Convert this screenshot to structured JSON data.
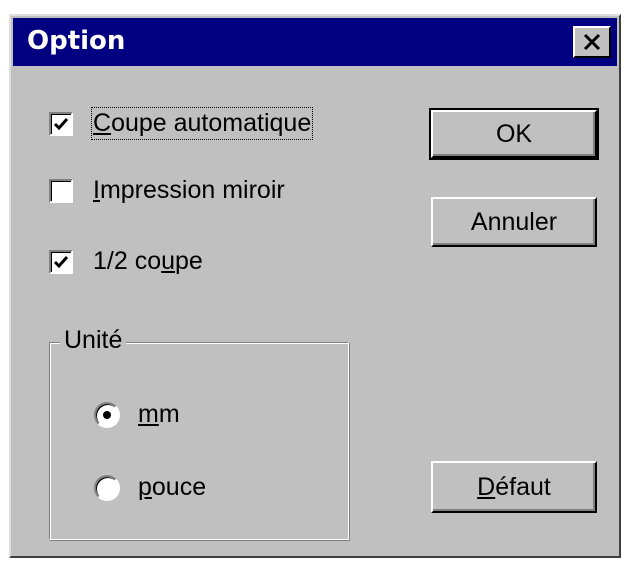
{
  "window": {
    "title": "Option",
    "close_symbol": "close-icon"
  },
  "options": {
    "auto_cut": {
      "first": "C",
      "rest": "oupe automatique",
      "checked": true
    },
    "mirror_print": {
      "first": "I",
      "rest": "mpression miroir",
      "checked": false
    },
    "half_cut": {
      "pre": "1/2 co",
      "acc": "u",
      "post": "pe",
      "checked": true
    }
  },
  "units": {
    "legend": "Unité",
    "mm": {
      "first": "m",
      "rest": "m",
      "selected": true
    },
    "inch": {
      "first": "p",
      "rest": "ouce",
      "selected": false
    }
  },
  "buttons": {
    "ok": "OK",
    "cancel": "Annuler",
    "default_pre": "D",
    "default_rest": "éfaut"
  },
  "colors": {
    "titlebar": "#000080",
    "face": "#c0c0c0"
  }
}
